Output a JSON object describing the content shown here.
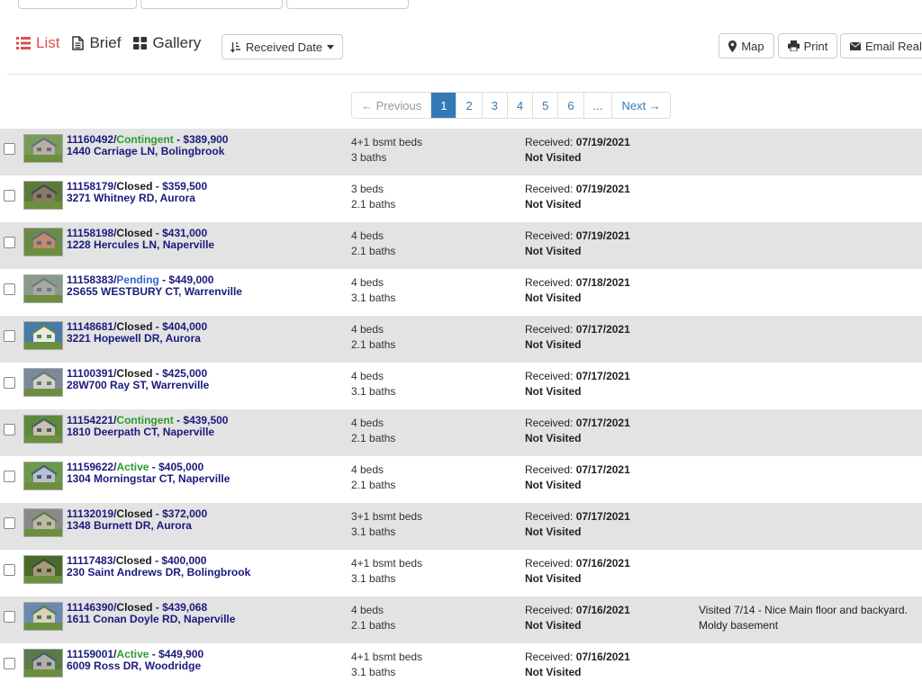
{
  "view_tabs": {
    "list": "List",
    "brief": "Brief",
    "gallery": "Gallery"
  },
  "sort": {
    "label": "Received Date"
  },
  "actions": {
    "map": "Map",
    "print": "Print",
    "email": "Email Realt"
  },
  "pagination": {
    "prev": "← Previous",
    "pages": [
      "1",
      "2",
      "3",
      "4",
      "5",
      "6",
      "..."
    ],
    "next": "Next →",
    "current": "1"
  },
  "labels": {
    "received": "Received: ",
    "not_visited": "Not Visited"
  },
  "listings": [
    {
      "id": "11160492",
      "status": "Contingent",
      "price": " - $389,900",
      "address": "1440 Carriage LN, Bolingbrook",
      "beds": "4+1 bsmt beds",
      "baths": "3 baths",
      "received_date": "07/19/2021",
      "visited": "Not Visited",
      "note": ""
    },
    {
      "id": "11158179",
      "status": "Closed",
      "price": " - $359,500",
      "address": "3271 Whitney RD, Aurora",
      "beds": "3 beds",
      "baths": "2.1 baths",
      "received_date": "07/19/2021",
      "visited": "Not Visited",
      "note": ""
    },
    {
      "id": "11158198",
      "status": "Closed",
      "price": " - $431,000",
      "address": "1228 Hercules LN, Naperville",
      "beds": "4 beds",
      "baths": "2.1 baths",
      "received_date": "07/19/2021",
      "visited": "Not Visited",
      "note": ""
    },
    {
      "id": "11158383",
      "status": "Pending",
      "price": " - $449,000",
      "address": "2S655 WESTBURY CT, Warrenville",
      "beds": "4 beds",
      "baths": "3.1 baths",
      "received_date": "07/18/2021",
      "visited": "Not Visited",
      "note": ""
    },
    {
      "id": "11148681",
      "status": "Closed",
      "price": " - $404,000",
      "address": "3221 Hopewell DR, Aurora",
      "beds": "4 beds",
      "baths": "2.1 baths",
      "received_date": "07/17/2021",
      "visited": "Not Visited",
      "note": ""
    },
    {
      "id": "11100391",
      "status": "Closed",
      "price": " - $425,000",
      "address": "28W700 Ray ST, Warrenville",
      "beds": "4 beds",
      "baths": "3.1 baths",
      "received_date": "07/17/2021",
      "visited": "Not Visited",
      "note": ""
    },
    {
      "id": "11154221",
      "status": "Contingent",
      "price": " - $439,500",
      "address": "1810 Deerpath CT, Naperville",
      "beds": "4 beds",
      "baths": "2.1 baths",
      "received_date": "07/17/2021",
      "visited": "Not Visited",
      "note": ""
    },
    {
      "id": "11159622",
      "status": "Active",
      "price": " - $405,000",
      "address": "1304 Morningstar CT, Naperville",
      "beds": "4 beds",
      "baths": "2.1 baths",
      "received_date": "07/17/2021",
      "visited": "Not Visited",
      "note": ""
    },
    {
      "id": "11132019",
      "status": "Closed",
      "price": " - $372,000",
      "address": "1348 Burnett DR, Aurora",
      "beds": "3+1 bsmt beds",
      "baths": "3.1 baths",
      "received_date": "07/17/2021",
      "visited": "Not Visited",
      "note": ""
    },
    {
      "id": "11117483",
      "status": "Closed",
      "price": " - $400,000",
      "address": "230 Saint Andrews DR, Bolingbrook",
      "beds": "4+1 bsmt beds",
      "baths": "3.1 baths",
      "received_date": "07/16/2021",
      "visited": "Not Visited",
      "note": ""
    },
    {
      "id": "11146390",
      "status": "Closed",
      "price": " - $439,068",
      "address": "1611 Conan Doyle RD, Naperville",
      "beds": "4 beds",
      "baths": "2.1 baths",
      "received_date": "07/16/2021",
      "visited": "Not Visited",
      "note": "Visited 7/14 - Nice Main floor and backyard. Moldy basement"
    },
    {
      "id": "11159001",
      "status": "Active",
      "price": " - $449,900",
      "address": "6009 Ross DR, Woodridge",
      "beds": "4+1 bsmt beds",
      "baths": "3.1 baths",
      "received_date": "07/16/2021",
      "visited": "Not Visited",
      "note": ""
    }
  ],
  "colors": {
    "accent": "#d9534f",
    "link": "#337ab7",
    "address": "#1a1a7e",
    "status_active": "#2e9a2e",
    "status_pending": "#3366cc",
    "row_alt": "#e3e3e3"
  },
  "icons": {
    "list": "list-icon",
    "brief": "document-icon",
    "gallery": "grid-icon",
    "sort": "sort-icon",
    "map": "map-marker-icon",
    "print": "print-icon",
    "email": "envelope-icon"
  }
}
